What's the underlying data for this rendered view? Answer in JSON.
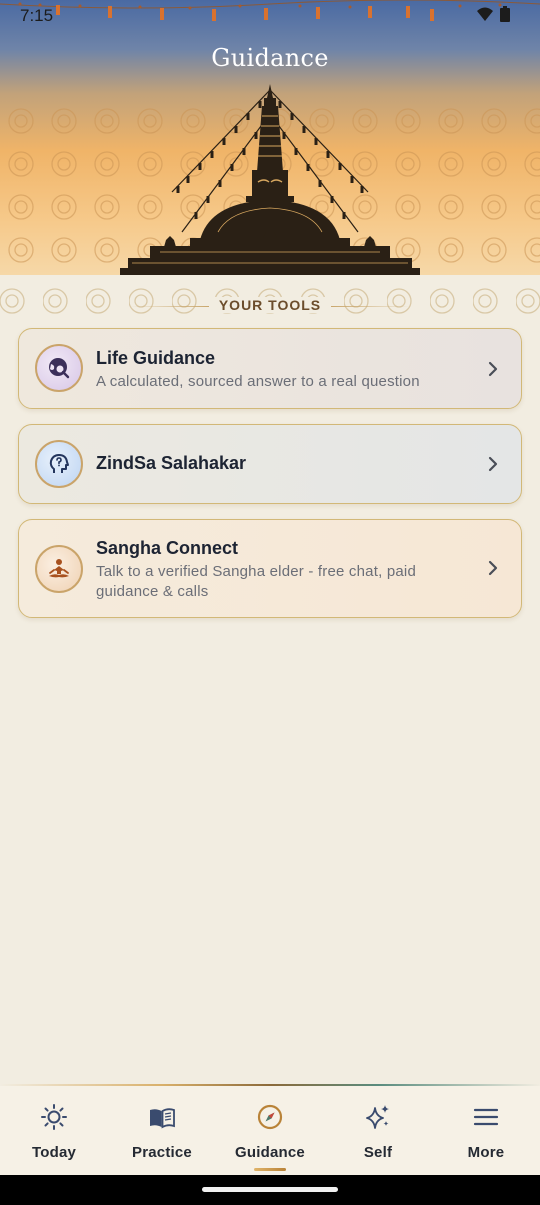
{
  "status_bar": {
    "time": "7:15",
    "icons": [
      "wifi-icon",
      "battery-icon"
    ]
  },
  "header": {
    "title": "Guidance"
  },
  "section": {
    "label": "YOUR TOOLS"
  },
  "tools": [
    {
      "title": "Life Guidance",
      "subtitle": "A calculated, sourced answer to a real question",
      "icon": "search-globe-icon",
      "accent": "#d7c6e6"
    },
    {
      "title": "ZindSa Salahakar",
      "subtitle": "",
      "icon": "head-question-icon",
      "accent": "#bdd4f2"
    },
    {
      "title": "Sangha Connect",
      "subtitle": "Talk to a verified Sangha elder - free chat, paid guidance & calls",
      "icon": "meditation-icon",
      "accent": "#efd1b2"
    }
  ],
  "nav": {
    "active": "Guidance",
    "items": [
      {
        "label": "Today",
        "icon": "sun-icon"
      },
      {
        "label": "Practice",
        "icon": "book-icon"
      },
      {
        "label": "Guidance",
        "icon": "compass-icon"
      },
      {
        "label": "Self",
        "icon": "sparkle-icon"
      },
      {
        "label": "More",
        "icon": "menu-icon"
      }
    ]
  },
  "colors": {
    "background": "#f2ede1",
    "accent_gold": "#c9a66b",
    "text_dark": "#1d2433",
    "active_nav": "#b98338"
  }
}
